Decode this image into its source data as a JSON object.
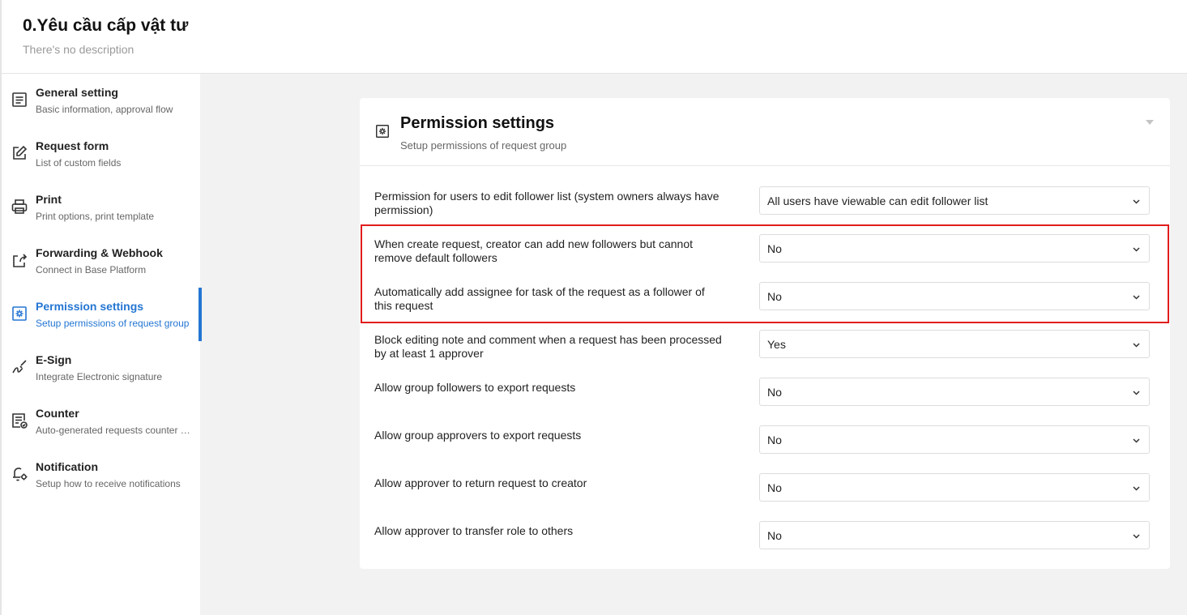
{
  "header": {
    "title": "0.Yêu cầu cấp vật tư",
    "description": "There's no description"
  },
  "sidebar": {
    "items": [
      {
        "label": "General setting",
        "sub": "Basic information, approval flow",
        "icon": "list-document-icon"
      },
      {
        "label": "Request form",
        "sub": "List of custom fields",
        "icon": "edit-icon"
      },
      {
        "label": "Print",
        "sub": "Print options, print template",
        "icon": "printer-icon"
      },
      {
        "label": "Forwarding & Webhook",
        "sub": "Connect in Base Platform",
        "icon": "share-icon"
      },
      {
        "label": "Permission settings",
        "sub": "Setup permissions of request group",
        "icon": "gear-icon",
        "active": true
      },
      {
        "label": "E-Sign",
        "sub": "Integrate Electronic signature",
        "icon": "signature-icon"
      },
      {
        "label": "Counter",
        "sub": "Auto-generated requests counter configuration",
        "icon": "counter-icon"
      },
      {
        "label": "Notification",
        "sub": "Setup how to receive notifications",
        "icon": "bell-gear-icon"
      }
    ]
  },
  "card": {
    "title": "Permission settings",
    "subtitle": "Setup permissions of request group",
    "icon": "gear-icon",
    "rows": [
      {
        "label": "Permission for users to edit follower list (system owners always have permission)",
        "value": "All users have viewable can edit follower list"
      },
      {
        "label": "When create request, creator can add new followers but cannot remove default followers",
        "value": "No"
      },
      {
        "label": "Automatically add assignee for task of the request as a follower of this request",
        "value": "No"
      },
      {
        "label": "Block editing note and comment when a request has been processed by at least 1 approver",
        "value": "Yes"
      },
      {
        "label": "Allow group followers to export requests",
        "value": "No"
      },
      {
        "label": "Allow group approvers to export requests",
        "value": "No"
      },
      {
        "label": "Allow approver to return request to creator",
        "value": "No"
      },
      {
        "label": "Allow approver to transfer role to others",
        "value": "No"
      }
    ]
  },
  "colors": {
    "accent": "#2476d3",
    "highlight": "#e11d1d"
  }
}
